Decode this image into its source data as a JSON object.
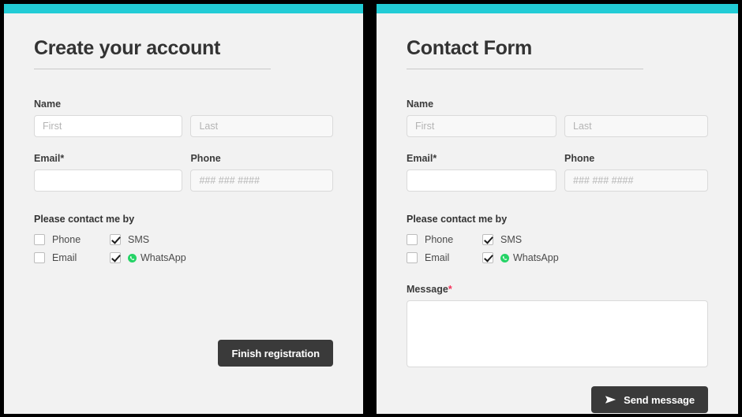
{
  "theme": {
    "accent_color": "#22ccd6",
    "panel_background": "#f2f2f2",
    "button_color": "#3a3a3a",
    "required_marker_color": "#f5325b",
    "whatsapp_color": "#25d366",
    "page_background": "#000000"
  },
  "left_panel": {
    "heading": "Create your account",
    "name_group": {
      "label": "Name",
      "first": {
        "value": "",
        "placeholder": "First"
      },
      "last": {
        "value": "",
        "placeholder": "Last"
      }
    },
    "email_label": "Email*",
    "email": {
      "value": "",
      "placeholder": ""
    },
    "phone_label": "Phone",
    "phone": {
      "value": "",
      "placeholder": "### ### ####"
    },
    "contact_preferences": {
      "title": "Please contact me by",
      "options": [
        {
          "label": "Phone",
          "checked": false,
          "icon": ""
        },
        {
          "label": "SMS",
          "checked": true,
          "icon": ""
        },
        {
          "label": "Email",
          "checked": false,
          "icon": ""
        },
        {
          "label": "WhatsApp",
          "checked": true,
          "icon": "whatsapp-icon"
        }
      ]
    },
    "submit_button": {
      "label": "Finish registration",
      "icon": ""
    }
  },
  "right_panel": {
    "heading": "Contact Form",
    "name_group": {
      "label": "Name",
      "first": {
        "value": "",
        "placeholder": "First"
      },
      "last": {
        "value": "",
        "placeholder": "Last"
      }
    },
    "email_label": "Email*",
    "email": {
      "value": "",
      "placeholder": ""
    },
    "phone_label": "Phone",
    "phone": {
      "value": "",
      "placeholder": "### ### ####"
    },
    "contact_preferences": {
      "title": "Please contact me by",
      "options": [
        {
          "label": "Phone",
          "checked": false,
          "icon": ""
        },
        {
          "label": "SMS",
          "checked": true,
          "icon": ""
        },
        {
          "label": "Email",
          "checked": false,
          "icon": ""
        },
        {
          "label": "WhatsApp",
          "checked": true,
          "icon": "whatsapp-icon"
        }
      ]
    },
    "message_label": "Message",
    "message_required_marker": "*",
    "message": {
      "value": "",
      "placeholder": ""
    },
    "submit_button": {
      "label": "Send message",
      "icon": "send-plane-icon"
    }
  }
}
